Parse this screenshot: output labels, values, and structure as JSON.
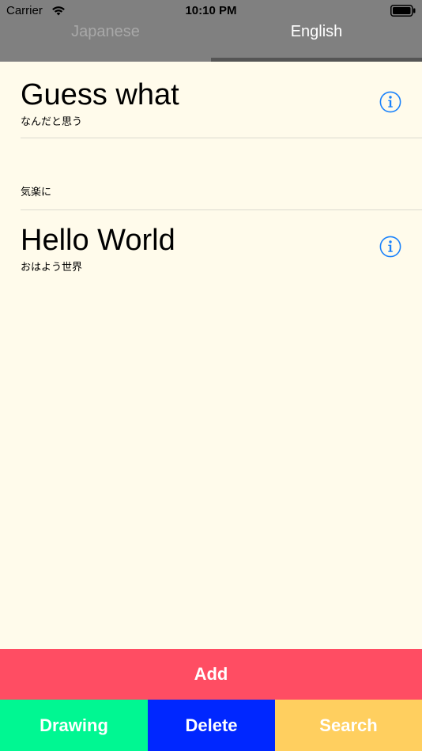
{
  "status_bar": {
    "carrier": "Carrier",
    "time": "10:10 PM",
    "icons": [
      "wifi-icon",
      "battery-icon"
    ]
  },
  "tabs": [
    {
      "label": "Japanese",
      "selected": false
    },
    {
      "label": "English",
      "selected": true
    }
  ],
  "rows": [
    {
      "title": "Guess what",
      "subtitle": "なんだと思う",
      "icon": "info-icon"
    },
    {
      "title": "",
      "subtitle": "気楽に"
    },
    {
      "title": "Hello World",
      "subtitle": "おはよう世界",
      "icon": "info-icon"
    }
  ],
  "buttons": {
    "add": "Add",
    "drawing": "Drawing",
    "delete": "Delete",
    "search": "Search"
  },
  "colors": {
    "header": "#808080",
    "background": "#fffbeb",
    "accent": "#1a82fb",
    "add": "#ff4d63",
    "drawing": "#00f792",
    "delete": "#0027ff",
    "search": "#ffcf5f"
  }
}
